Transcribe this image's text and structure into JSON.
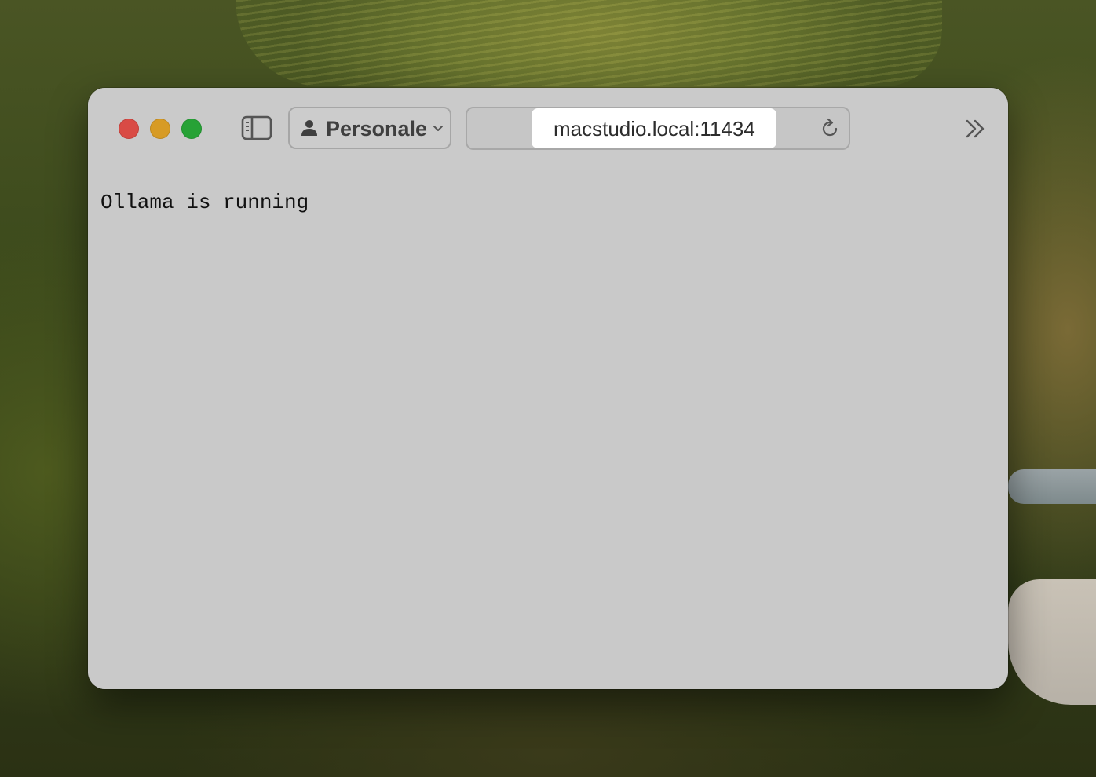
{
  "window": {
    "traffic_lights": [
      {
        "name": "close",
        "color": "#d94b45"
      },
      {
        "name": "minimize",
        "color": "#d79b25"
      },
      {
        "name": "zoom",
        "color": "#27a236"
      }
    ]
  },
  "toolbar": {
    "sidebar_icon": "sidebar-icon",
    "profile": {
      "label": "Personale",
      "icon": "person-icon",
      "chevron": "chevron-down-icon"
    },
    "address": {
      "url": "macstudio.local:11434",
      "reload_icon": "reload-icon"
    },
    "more_icon": "double-chevron-right-icon"
  },
  "page": {
    "body_text": "Ollama is running"
  }
}
